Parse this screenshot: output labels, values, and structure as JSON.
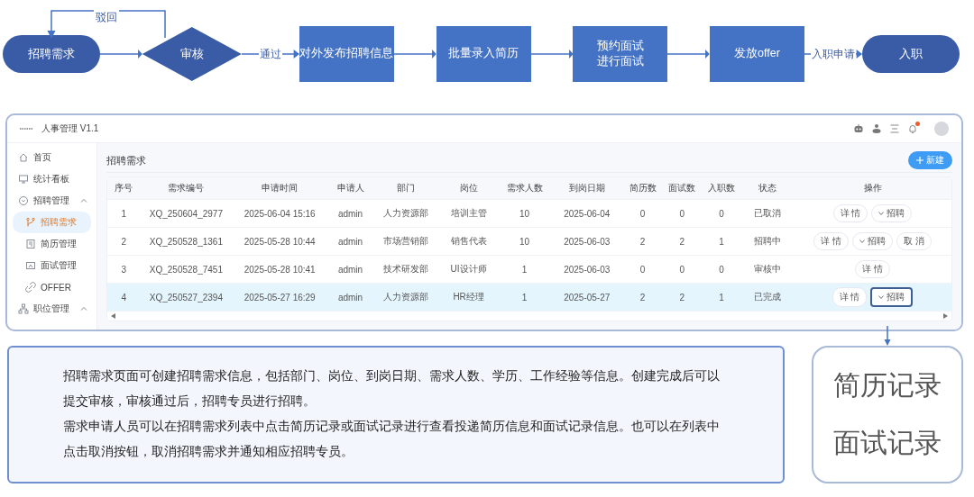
{
  "flowchart": {
    "loop_label": "驳回",
    "nodes": [
      {
        "kind": "terminal",
        "lines": [
          "招聘需求"
        ]
      },
      {
        "kind": "decision",
        "lines": [
          "审核"
        ],
        "exit_label": "通过"
      },
      {
        "kind": "process",
        "lines": [
          "对外发布招聘信息"
        ]
      },
      {
        "kind": "process",
        "lines": [
          "批量录入简历"
        ]
      },
      {
        "kind": "process",
        "lines": [
          "预约面试",
          "进行面试"
        ]
      },
      {
        "kind": "process",
        "lines": [
          "发放offer"
        ],
        "exit_label": "入职申请"
      },
      {
        "kind": "terminal",
        "lines": [
          "入职"
        ]
      }
    ]
  },
  "app": {
    "title": "人事管理 V1.1",
    "notification_badge": true,
    "sidebar": [
      {
        "label": "首页",
        "selected": false
      },
      {
        "label": "统计看板",
        "selected": false
      },
      {
        "label": "招聘管理",
        "selected": false,
        "expanded": true,
        "children": [
          {
            "label": "招聘需求",
            "selected": true
          },
          {
            "label": "简历管理",
            "selected": false
          },
          {
            "label": "面试管理",
            "selected": false
          },
          {
            "label": "OFFER",
            "selected": false
          }
        ]
      },
      {
        "label": "职位管理",
        "selected": false,
        "expanded": true
      }
    ],
    "page_title": "招聘需求",
    "new_button": "新建",
    "table": {
      "columns": [
        "序号",
        "需求编号",
        "申请时间",
        "申请人",
        "部门",
        "岗位",
        "需求人数",
        "到岗日期",
        "简历数",
        "面试数",
        "入职数",
        "状态",
        "操作"
      ],
      "rows": [
        {
          "selected": false,
          "cells": [
            "1",
            "XQ_250604_2977",
            "2025-06-04 15:16",
            "admin",
            "人力资源部",
            "培训主管",
            "10",
            "2025-06-04",
            "0",
            "0",
            "0",
            "已取消"
          ],
          "actions": [
            {
              "kind": "plain",
              "label": "详 情",
              "highlighted": false
            },
            {
              "kind": "dropdown",
              "label": "招聘",
              "highlighted": false
            }
          ]
        },
        {
          "selected": false,
          "cells": [
            "2",
            "XQ_250528_1361",
            "2025-05-28 10:44",
            "admin",
            "市场营销部",
            "销售代表",
            "10",
            "2025-06-03",
            "2",
            "2",
            "1",
            "招聘中"
          ],
          "actions": [
            {
              "kind": "plain",
              "label": "详 情",
              "highlighted": false
            },
            {
              "kind": "dropdown",
              "label": "招聘",
              "highlighted": false
            },
            {
              "kind": "plain",
              "label": "取 消",
              "highlighted": false
            }
          ]
        },
        {
          "selected": false,
          "cells": [
            "3",
            "XQ_250528_7451",
            "2025-05-28 10:41",
            "admin",
            "技术研发部",
            "UI设计师",
            "1",
            "2025-06-03",
            "0",
            "0",
            "0",
            "审核中"
          ],
          "actions": [
            {
              "kind": "plain",
              "label": "详 情",
              "highlighted": false
            }
          ]
        },
        {
          "selected": true,
          "cells": [
            "4",
            "XQ_250527_2394",
            "2025-05-27 16:29",
            "admin",
            "人力资源部",
            "HR经理",
            "1",
            "2025-05-27",
            "2",
            "2",
            "1",
            "已完成"
          ],
          "actions": [
            {
              "kind": "plain",
              "label": "详 情",
              "highlighted": false
            },
            {
              "kind": "dropdown",
              "label": "招聘",
              "highlighted": true
            }
          ]
        }
      ]
    }
  },
  "description": [
    "招聘需求页面可创建招聘需求信息，包括部门、岗位、到岗日期、需求人数、学历、工作经验等信息。创建完成后可以提交审核，审核通过后，招聘专员进行招聘。",
    "需求申请人员可以在招聘需求列表中点击简历记录或面试记录进行查看投递简历信息和面试记录信息。也可以在列表中点击取消按钮，取消招聘需求并通知相应招聘专员。"
  ],
  "callout": [
    "简历记录",
    "面试记录"
  ]
}
